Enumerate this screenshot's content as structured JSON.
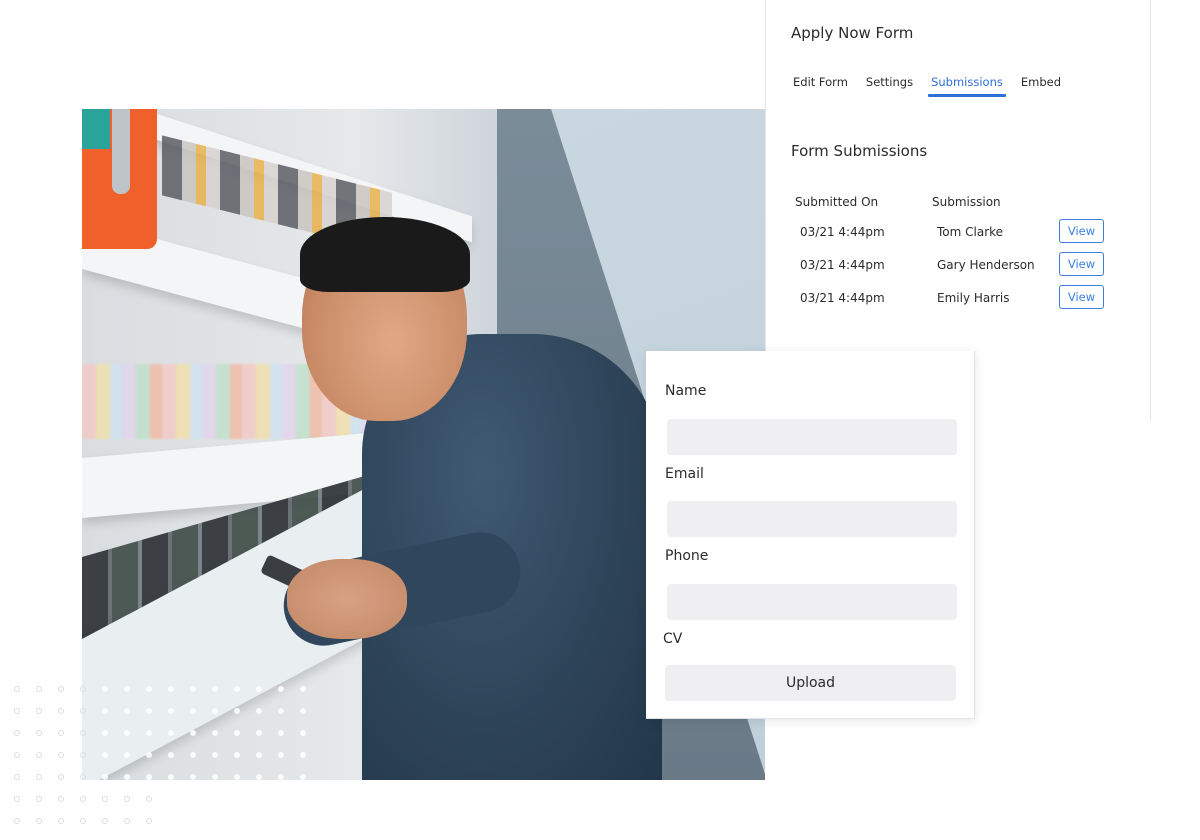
{
  "photo": {
    "description": "Smiling man in dark blue denim shirt looking at phone in front of retail shelves",
    "icon": "photo-image"
  },
  "submissions_panel": {
    "title": "Apply Now Form",
    "tabs": [
      {
        "label": "Edit Form",
        "active": false
      },
      {
        "label": "Settings",
        "active": false
      },
      {
        "label": "Submissions",
        "active": true
      },
      {
        "label": "Embed",
        "active": false
      }
    ],
    "section_title": "Form Submissions",
    "columns": [
      "Submitted On",
      "Submission"
    ],
    "rows": [
      {
        "submitted_on": "03/21 4:44pm",
        "submission": "Tom Clarke",
        "action": "View"
      },
      {
        "submitted_on": "03/21 4:44pm",
        "submission": "Gary Henderson",
        "action": "View"
      },
      {
        "submitted_on": "03/21 4:44pm",
        "submission": "Emily Harris",
        "action": "View"
      }
    ],
    "accent_color": "#2f6fd6"
  },
  "form_card": {
    "fields": [
      {
        "label": "Name",
        "value": "",
        "placeholder": ""
      },
      {
        "label": "Email",
        "value": "",
        "placeholder": ""
      },
      {
        "label": "Phone",
        "value": "",
        "placeholder": ""
      }
    ],
    "cv_label": "CV",
    "upload_label": "Upload"
  }
}
